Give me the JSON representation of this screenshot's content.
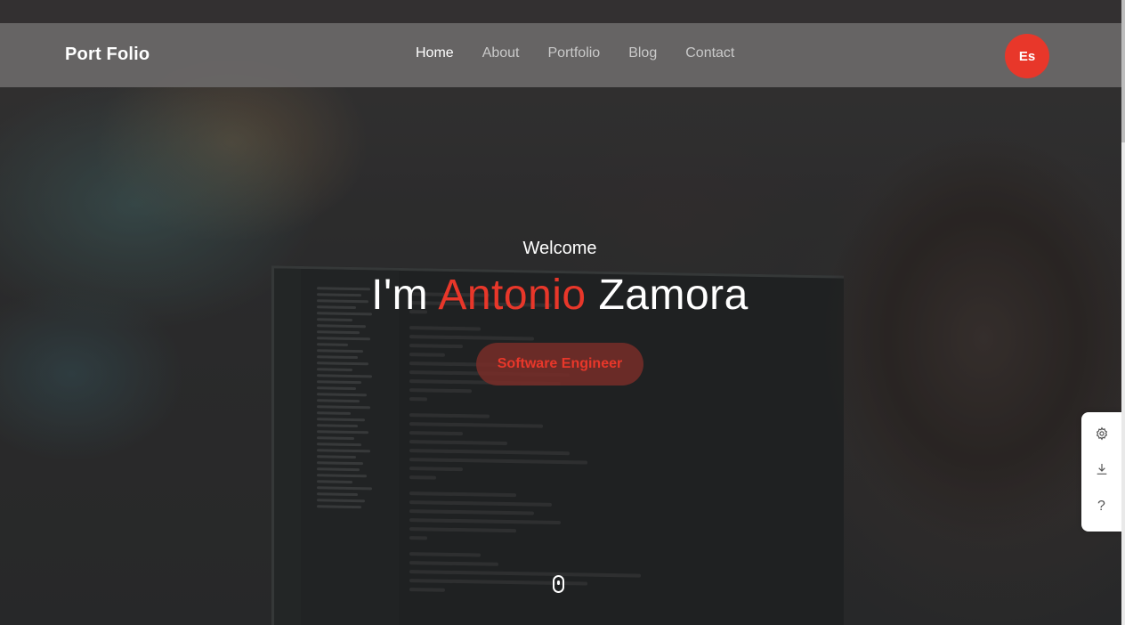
{
  "navbar": {
    "brand": "Port Folio",
    "links": [
      "Home",
      "About",
      "Portfolio",
      "Blog",
      "Contact"
    ],
    "active": "Home",
    "language_button": "Es"
  },
  "hero": {
    "welcome": "Welcome",
    "title_prefix": "I'm ",
    "title_accent": "Antonio",
    "title_suffix": " Zamora",
    "role": "Software Engineer",
    "scroll_icon": "mouse-scroll-icon"
  },
  "side_tools": {
    "items": [
      {
        "icon": "gear-icon"
      },
      {
        "icon": "download-icon"
      },
      {
        "icon": "help-icon",
        "label": "?"
      }
    ]
  },
  "colors": {
    "accent": "#e8372a",
    "navbar": "#696767",
    "text": "#ffffff"
  }
}
